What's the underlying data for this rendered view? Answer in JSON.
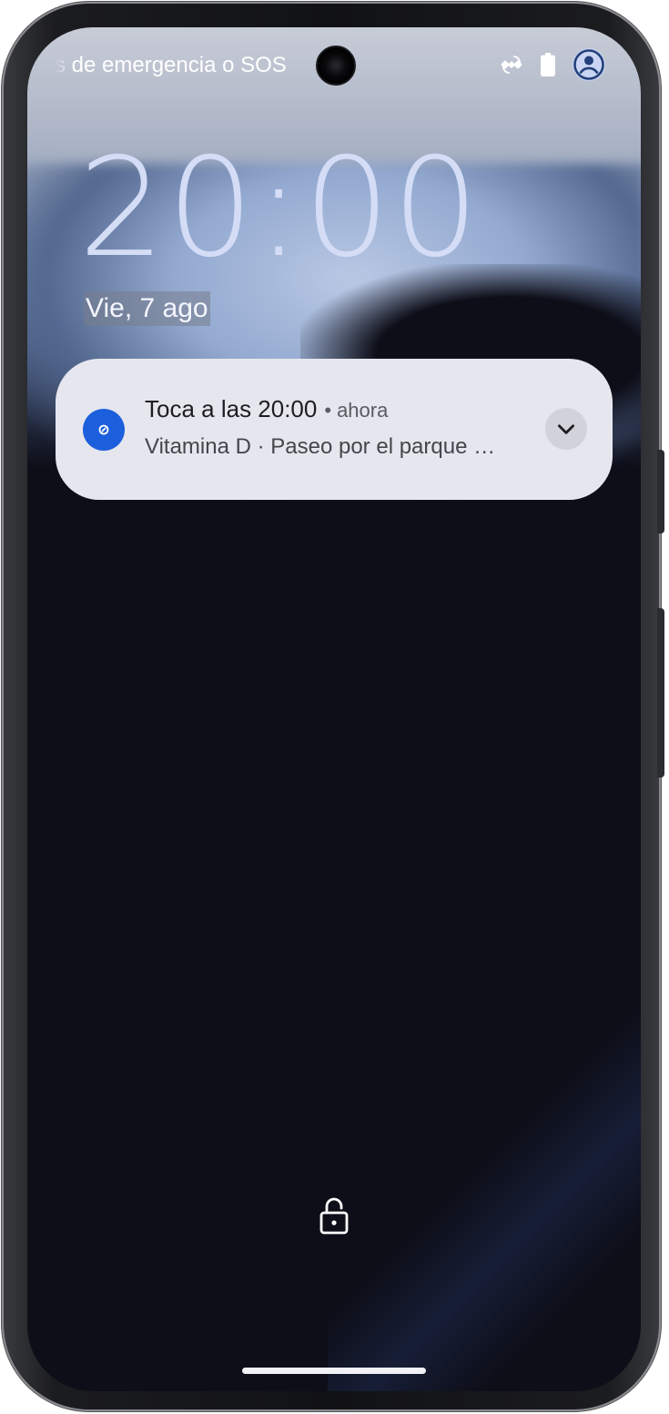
{
  "status_bar": {
    "scrolling_text": "s de emergencia o SOS",
    "icons": [
      "satellite-icon",
      "battery-icon",
      "account-icon"
    ]
  },
  "lockscreen": {
    "clock": "20:00",
    "date": "Vie, 7 ago"
  },
  "notification": {
    "app_icon": "reminder-app-icon",
    "title": "Toca a las 20:00",
    "separator": "•",
    "time": "ahora",
    "body": "Vitamina D · Paseo por el parque …",
    "expand_icon": "chevron-down-icon"
  },
  "bottom": {
    "lock_icon": "lock-icon"
  },
  "colors": {
    "accent": "#1b5fdc",
    "clock": "#d4dcf6",
    "notification_bg": "#e6e6ee",
    "wallpaper_dark": "#0d0e18"
  }
}
